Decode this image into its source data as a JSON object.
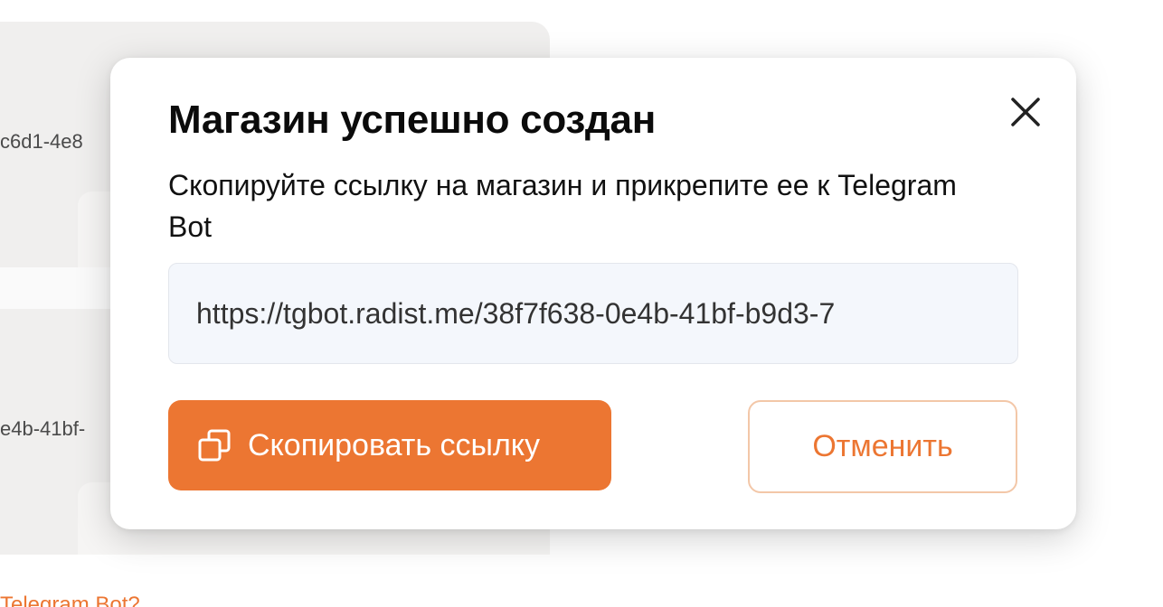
{
  "background": {
    "card_1_id_fragment": "c6d1-4e8",
    "card_2_id_fragment": "e4b-41bf-",
    "bottom_link": "Telegram Bot?"
  },
  "modal": {
    "title": "Магазин успешно создан",
    "description": "Скопируйте ссылку на магазин и прикрепите ее к Telegram Bot",
    "link_value": "https://tgbot.radist.me/38f7f638-0e4b-41bf-b9d3-7",
    "copy_button_label": "Скопировать ссылку",
    "cancel_button_label": "Отменить",
    "icons": {
      "close": "close-icon",
      "copy": "copy-icon"
    }
  },
  "colors": {
    "accent": "#ec7632",
    "accent_border": "#f3c7a8",
    "field_bg": "#f4f7fc"
  }
}
